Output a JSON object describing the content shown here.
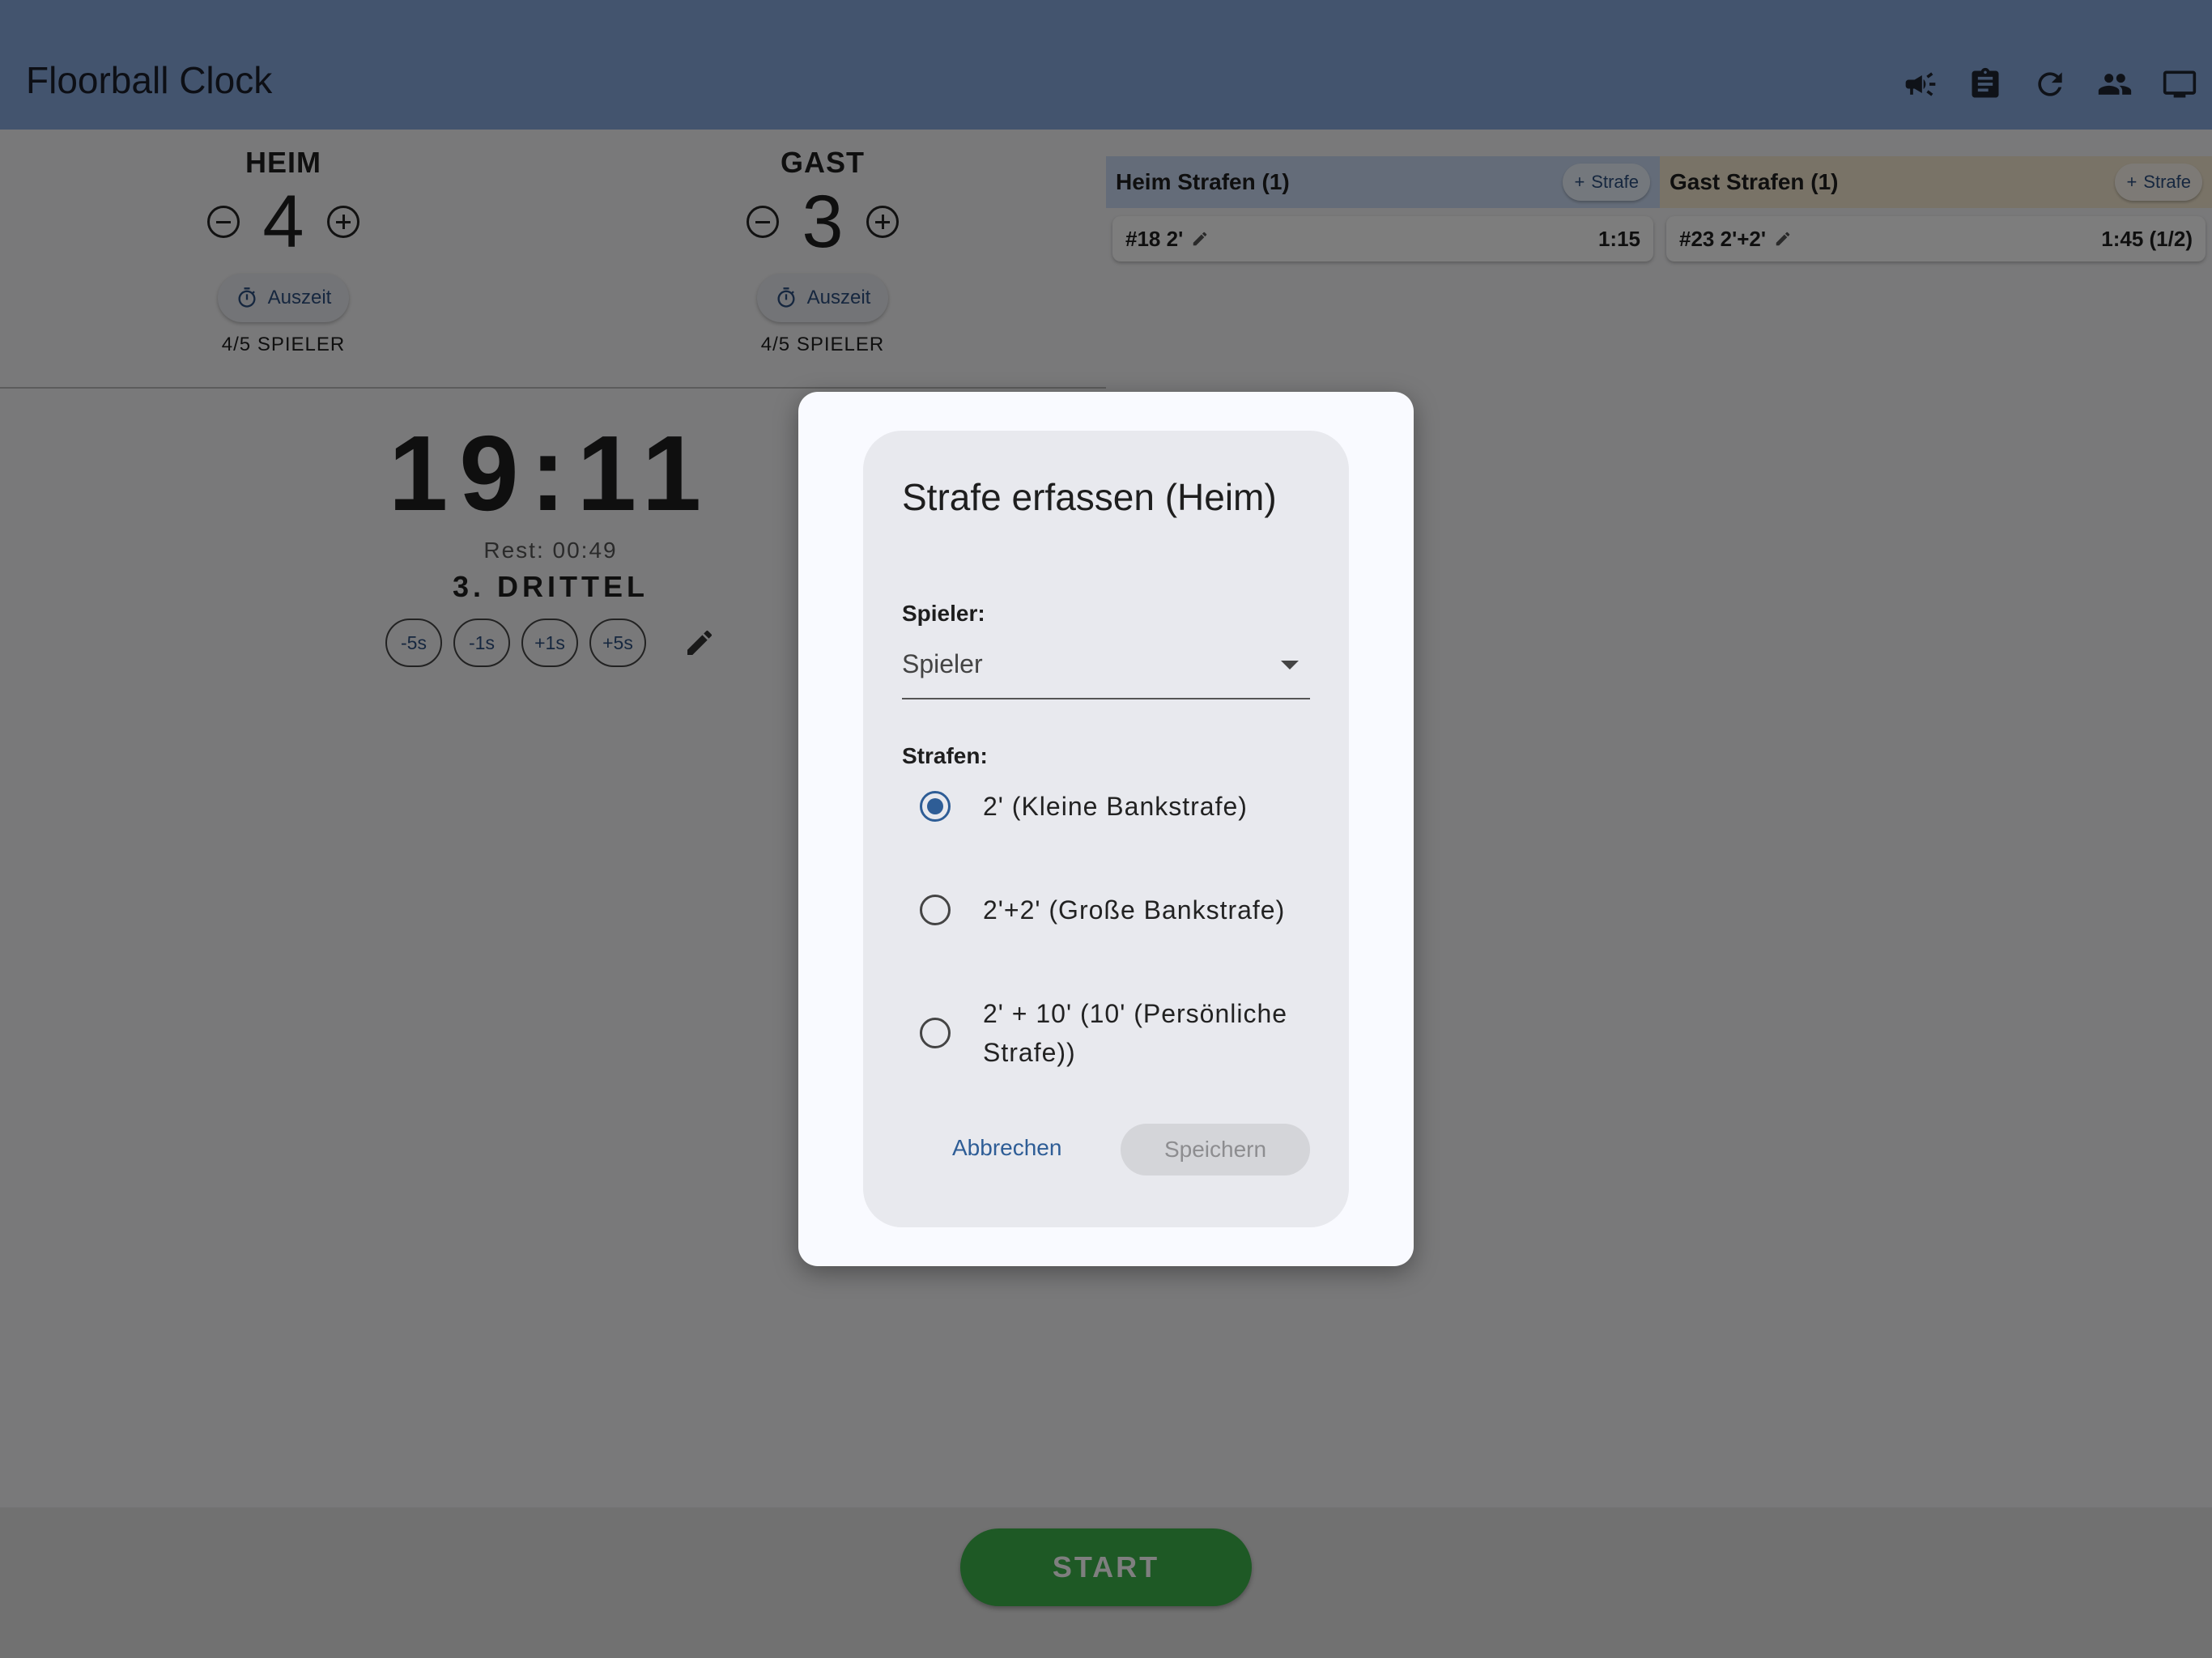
{
  "app": {
    "title": "Floorball Clock"
  },
  "toolbar": {
    "icons": [
      "megaphone-icon",
      "clipboard-icon",
      "refresh-icon",
      "people-icon",
      "monitor-icon"
    ]
  },
  "home": {
    "name": "HEIM",
    "score": "4",
    "timeout_label": "Auszeit",
    "players": "4/5 SPIELER"
  },
  "guest": {
    "name": "GAST",
    "score": "3",
    "timeout_label": "Auszeit",
    "players": "4/5 SPIELER"
  },
  "clock": {
    "time": "19:11",
    "rest": "Rest: 00:49",
    "period": "3. DRITTEL",
    "adjust": [
      "-5s",
      "-1s",
      "+1s",
      "+5s"
    ]
  },
  "penalties": {
    "home": {
      "title": "Heim Strafen (1)",
      "add_label": "Strafe",
      "items": [
        {
          "label": "#18 2'",
          "time": "1:15"
        }
      ],
      "color": "#c9d9f2"
    },
    "guest": {
      "title": "Gast Strafen (1)",
      "add_label": "Strafe",
      "items": [
        {
          "label": "#23 2'+2'",
          "time": "1:45 (1/2)"
        }
      ],
      "color": "#f3e7cf"
    }
  },
  "start_label": "START",
  "dialog": {
    "title": "Strafe erfassen (Heim)",
    "player_label": "Spieler:",
    "player_placeholder": "Spieler",
    "penalties_label": "Strafen:",
    "options": [
      {
        "text": "2' (Kleine Bankstrafe)",
        "selected": true
      },
      {
        "text": "2'+2' (Große Bankstrafe)",
        "selected": false
      },
      {
        "text": "2' + 10' (10' (Persönliche Strafe))",
        "selected": false
      }
    ],
    "cancel_label": "Abbrechen",
    "save_label": "Speichern"
  },
  "colors": {
    "appbar": "#86a9dc",
    "accent": "#2e5d96",
    "start": "#3cb34a"
  }
}
